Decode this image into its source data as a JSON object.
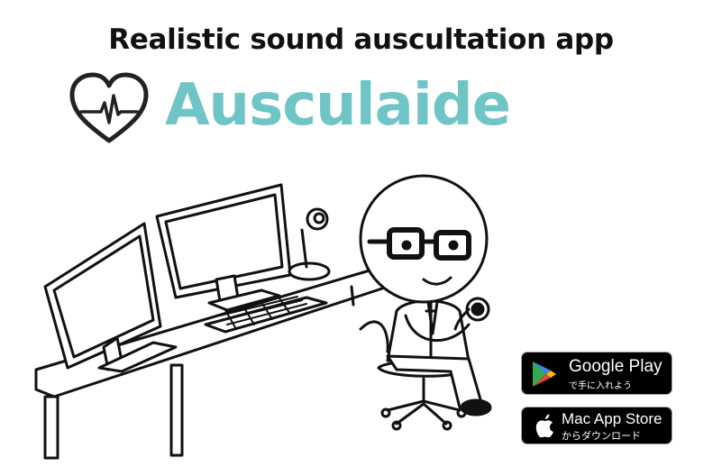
{
  "header": {
    "tagline": "Realistic sound auscultation app",
    "brand_name": "Ausculaide",
    "brand_color": "#6fc4c6",
    "logo_icon": "heart-pulse-icon"
  },
  "stores": {
    "google_play": {
      "title": "Google Play",
      "subtitle": "で手に入れよう",
      "icon": "google-play-icon"
    },
    "mac_app_store": {
      "title": "Mac App Store",
      "subtitle": "からダウンロード",
      "icon": "apple-icon"
    }
  }
}
